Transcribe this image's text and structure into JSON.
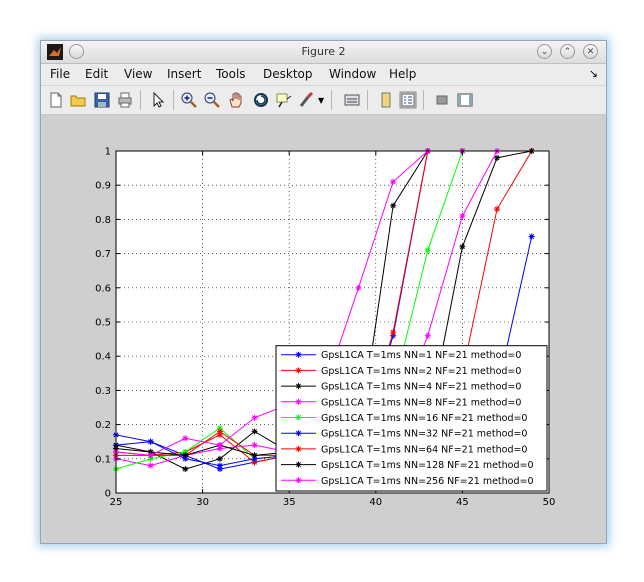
{
  "window": {
    "title": "Figure 2"
  },
  "menu": {
    "items": [
      "File",
      "Edit",
      "View",
      "Insert",
      "Tools",
      "Desktop",
      "Window",
      "Help"
    ],
    "corner": "↘"
  },
  "toolbar": {
    "icons": [
      "new-figure-icon",
      "open-file-icon",
      "save-icon",
      "print-icon",
      "pointer-icon",
      "zoom-in-icon",
      "zoom-out-icon",
      "pan-icon",
      "rotate-icon",
      "data-cursor-icon",
      "brush-icon",
      "link-icon",
      "colorbar-icon",
      "legend-icon",
      "hide-tools-icon",
      "show-tools-icon"
    ]
  },
  "chart_data": {
    "type": "line",
    "title": "",
    "xlabel": "",
    "ylabel": "",
    "xlim": [
      25,
      50
    ],
    "ylim": [
      0,
      1
    ],
    "xticks": [
      25,
      30,
      35,
      40,
      45,
      50
    ],
    "yticks": [
      0,
      0.1,
      0.2,
      0.3,
      0.4,
      0.5,
      0.6,
      0.7,
      0.8,
      0.9,
      1
    ],
    "grid": true,
    "legend_location": "bottom-right",
    "series": [
      {
        "name": "GpsL1CA T=1ms NN=1 NF=21 method=0",
        "color": "#0000ff",
        "x": [
          25,
          27,
          29,
          31,
          33,
          35,
          37,
          39,
          41,
          43,
          45,
          47,
          49
        ],
        "y": [
          0.17,
          0.15,
          0.11,
          0.07,
          0.09,
          0.11,
          0.1,
          0.1,
          0.11,
          0.12,
          0.14,
          0.3,
          0.75
        ]
      },
      {
        "name": "GpsL1CA T=1ms NN=2 NF=21 method=0",
        "color": "#ff0000",
        "x": [
          25,
          27,
          29,
          31,
          33,
          35,
          37,
          39,
          41,
          43,
          45,
          47,
          49
        ],
        "y": [
          0.11,
          0.11,
          0.12,
          0.17,
          0.09,
          0.11,
          0.12,
          0.13,
          0.14,
          0.18,
          0.35,
          0.83,
          1.0
        ]
      },
      {
        "name": "GpsL1CA T=1ms NN=4 NF=21 method=0",
        "color": "#000000",
        "x": [
          25,
          27,
          29,
          31,
          33,
          35,
          37,
          39,
          41,
          43,
          45,
          47,
          49
        ],
        "y": [
          0.13,
          0.12,
          0.07,
          0.1,
          0.18,
          0.12,
          0.1,
          0.11,
          0.12,
          0.2,
          0.72,
          0.98,
          1.0
        ]
      },
      {
        "name": "GpsL1CA T=1ms NN=8 NF=21 method=0",
        "color": "#ff00ff",
        "x": [
          25,
          27,
          29,
          31,
          33,
          35,
          37,
          39,
          41,
          43,
          45,
          47
        ],
        "y": [
          0.1,
          0.08,
          0.11,
          0.13,
          0.14,
          0.12,
          0.12,
          0.13,
          0.2,
          0.46,
          0.81,
          1.0
        ]
      },
      {
        "name": "GpsL1CA T=1ms NN=16 NF=21 method=0",
        "color": "#00ff00",
        "x": [
          25,
          27,
          29,
          31,
          33,
          35,
          37,
          39,
          41,
          43,
          45
        ],
        "y": [
          0.07,
          0.1,
          0.12,
          0.19,
          0.1,
          0.11,
          0.12,
          0.13,
          0.3,
          0.71,
          1.0
        ]
      },
      {
        "name": "GpsL1CA T=1ms NN=32 NF=21 method=0",
        "color": "#0000ff",
        "x": [
          25,
          27,
          29,
          31,
          33,
          35,
          37,
          39,
          41,
          43,
          45
        ],
        "y": [
          0.14,
          0.15,
          0.1,
          0.08,
          0.1,
          0.11,
          0.1,
          0.12,
          0.46,
          1.0,
          1.0
        ]
      },
      {
        "name": "GpsL1CA T=1ms NN=64 NF=21 method=0",
        "color": "#ff0000",
        "x": [
          25,
          27,
          29,
          31,
          33,
          35,
          37,
          39,
          41,
          43,
          45
        ],
        "y": [
          0.12,
          0.11,
          0.11,
          0.18,
          0.11,
          0.11,
          0.12,
          0.13,
          0.47,
          1.0,
          1.0
        ]
      },
      {
        "name": "GpsL1CA T=1ms NN=128 NF=21 method=0",
        "color": "#000000",
        "x": [
          25,
          27,
          29,
          31,
          33,
          35,
          37,
          39,
          41,
          43,
          45
        ],
        "y": [
          0.14,
          0.12,
          0.11,
          0.14,
          0.11,
          0.12,
          0.13,
          0.15,
          0.84,
          1.0,
          1.0
        ]
      },
      {
        "name": "GpsL1CA T=1ms NN=256 NF=21 method=0",
        "color": "#ff00ff",
        "x": [
          25,
          27,
          29,
          31,
          33,
          35,
          37,
          39,
          41,
          43,
          45
        ],
        "y": [
          0.12,
          0.11,
          0.16,
          0.14,
          0.22,
          0.26,
          0.3,
          0.6,
          0.91,
          1.0,
          1.0
        ]
      }
    ]
  }
}
